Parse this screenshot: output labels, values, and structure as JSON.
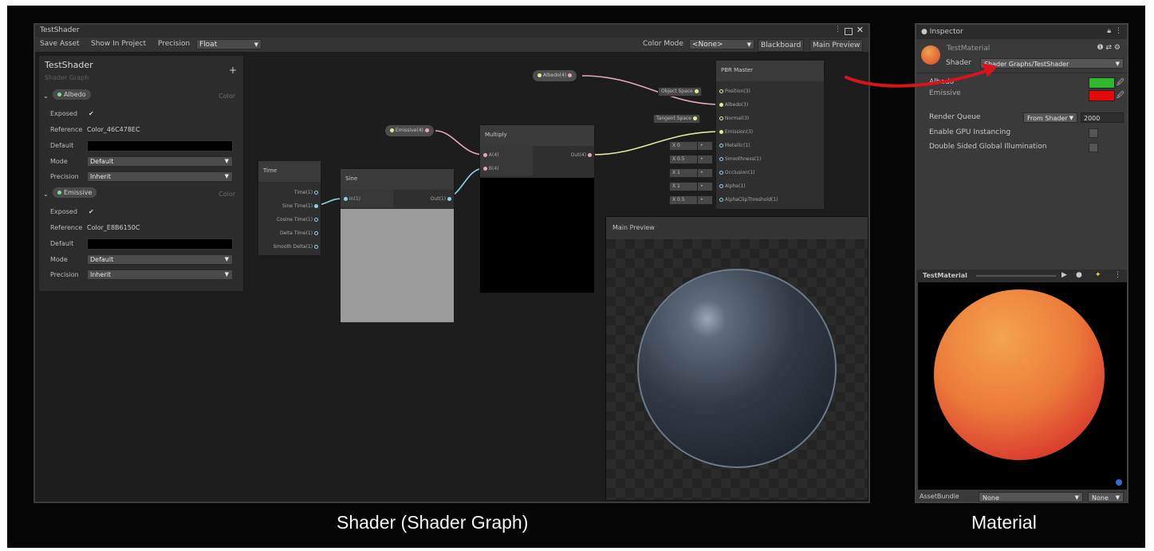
{
  "shader_window": {
    "title": "TestShader",
    "toolbar": {
      "save_asset": "Save Asset",
      "show_in_project": "Show In Project",
      "precision_label": "Precision",
      "precision_value": "Float",
      "color_mode_label": "Color Mode",
      "color_mode_value": "<None>",
      "blackboard": "Blackboard",
      "main_preview": "Main Preview"
    },
    "blackboard": {
      "title": "TestShader",
      "subtitle": "Shader Graph",
      "properties": [
        {
          "name": "Albedo",
          "type": "Color",
          "exposed_label": "Exposed",
          "exposed_check": "✔",
          "reference_label": "Reference",
          "reference": "Color_46C478EC",
          "default_label": "Default",
          "mode_label": "Mode",
          "mode": "Default",
          "precision_label": "Precision",
          "precision": "Inherit"
        },
        {
          "name": "Emissive",
          "type": "Color",
          "exposed_label": "Exposed",
          "exposed_check": "✔",
          "reference_label": "Reference",
          "reference": "Color_E8B6150C",
          "default_label": "Default",
          "mode_label": "Mode",
          "mode": "Default",
          "precision_label": "Precision",
          "precision": "Inherit"
        }
      ]
    },
    "nodes": {
      "time": {
        "title": "Time",
        "outputs": [
          "Time(1)",
          "Sine Time(1)",
          "Cosine Time(1)",
          "Delta Time(1)",
          "Smooth Delta(1)"
        ]
      },
      "sine": {
        "title": "Sine",
        "input": "In(1)",
        "output": "Out(1)"
      },
      "multiply": {
        "title": "Multiply",
        "input_a": "A(4)",
        "input_b": "B(4)",
        "output": "Out(4)"
      },
      "albedo_prop": "Albedo(4)",
      "emissive_prop": "Emissive(4)",
      "pbr": {
        "title": "PBR Master",
        "inputs": [
          "Position(3)",
          "Albedo(3)",
          "Normal(3)",
          "Emission(3)",
          "Metallic(1)",
          "Smoothness(1)",
          "Occlusion(1)",
          "Alpha(1)",
          "AlphaClipThreshold(1)"
        ],
        "object_space": "Object Space",
        "tangent_space": "Tangent Space",
        "values": [
          "X  0",
          "X  0.5",
          "X  1",
          "X  1",
          "X  0.5"
        ]
      }
    },
    "main_preview_title": "Main Preview"
  },
  "inspector": {
    "tab": "Inspector",
    "material_name": "TestMaterial",
    "shader_label": "Shader",
    "shader_value": "Shader Graphs/TestShader",
    "albedo_label": "Albedo",
    "emissive_label": "Emissive",
    "render_queue_label": "Render Queue",
    "render_queue_mode": "From Shader",
    "render_queue_value": "2000",
    "gpu_instancing_label": "Enable GPU Instancing",
    "double_sided_gi_label": "Double Sided Global Illumination",
    "preview_title": "TestMaterial",
    "assetbundle_label": "AssetBundle",
    "assetbundle_value": "None",
    "assetbundle_variant": "None",
    "colors": {
      "albedo": "#2fb82f",
      "emissive": "#e80a0a"
    }
  },
  "captions": {
    "left": "Shader (Shader Graph)",
    "right": "Material"
  }
}
